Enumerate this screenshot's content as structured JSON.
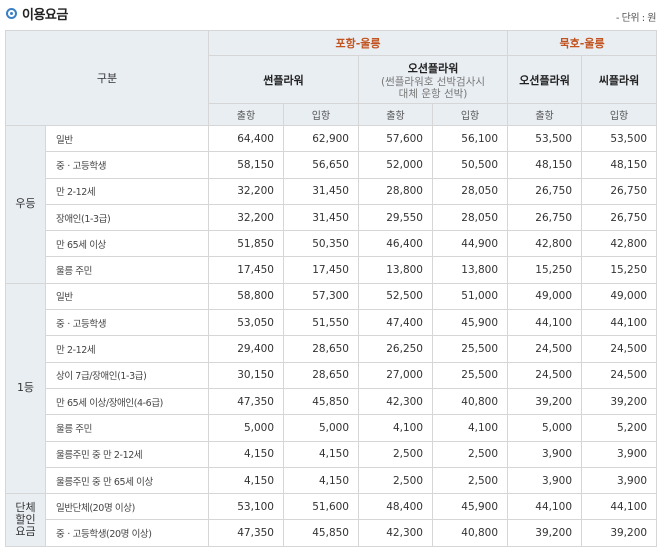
{
  "header": {
    "title": "이용요금",
    "unit": "- 단위 : 원"
  },
  "table": {
    "gubun": "구분",
    "groups": [
      {
        "label": "포항-울릉"
      },
      {
        "label": "묵호-울릉"
      }
    ],
    "ships": [
      {
        "name": "썬플라워",
        "sub": ""
      },
      {
        "name": "오션플라워",
        "sub": "(썬플라워호 선박검사시\n대체 운항 선박)"
      },
      {
        "name": "오션플라워",
        "sub": ""
      },
      {
        "name": "씨플라워",
        "sub": ""
      }
    ],
    "dirs": [
      "출항",
      "입항",
      "출항",
      "입항",
      "출항",
      "입항"
    ],
    "sections": [
      {
        "cls": "우등",
        "rows": [
          {
            "label": "일반",
            "values": [
              "64,400",
              "62,900",
              "57,600",
              "56,100",
              "53,500",
              "53,500"
            ]
          },
          {
            "label": "중ㆍ고등학생",
            "values": [
              "58,150",
              "56,650",
              "52,000",
              "50,500",
              "48,150",
              "48,150"
            ]
          },
          {
            "label": "만 2-12세",
            "values": [
              "32,200",
              "31,450",
              "28,800",
              "28,050",
              "26,750",
              "26,750"
            ]
          },
          {
            "label": "장애인(1-3급)",
            "values": [
              "32,200",
              "31,450",
              "29,550",
              "28,050",
              "26,750",
              "26,750"
            ]
          },
          {
            "label": "만 65세 이상",
            "values": [
              "51,850",
              "50,350",
              "46,400",
              "44,900",
              "42,800",
              "42,800"
            ]
          },
          {
            "label": "울릉 주민",
            "values": [
              "17,450",
              "17,450",
              "13,800",
              "13,800",
              "15,250",
              "15,250"
            ]
          }
        ]
      },
      {
        "cls": "1등",
        "rows": [
          {
            "label": "일반",
            "values": [
              "58,800",
              "57,300",
              "52,500",
              "51,000",
              "49,000",
              "49,000"
            ]
          },
          {
            "label": "중ㆍ고등학생",
            "values": [
              "53,050",
              "51,550",
              "47,400",
              "45,900",
              "44,100",
              "44,100"
            ]
          },
          {
            "label": "만 2-12세",
            "values": [
              "29,400",
              "28,650",
              "26,250",
              "25,500",
              "24,500",
              "24,500"
            ]
          },
          {
            "label": "상이 7급/장애인(1-3급)",
            "values": [
              "30,150",
              "28,650",
              "27,000",
              "25,500",
              "24,500",
              "24,500"
            ]
          },
          {
            "label": "만 65세 이상/장애인(4-6급)",
            "values": [
              "47,350",
              "45,850",
              "42,300",
              "40,800",
              "39,200",
              "39,200"
            ]
          },
          {
            "label": "울릉 주민",
            "values": [
              "5,000",
              "5,000",
              "4,100",
              "4,100",
              "5,000",
              "5,200"
            ]
          },
          {
            "label": "울릉주민 중 만 2-12세",
            "values": [
              "4,150",
              "4,150",
              "2,500",
              "2,500",
              "3,900",
              "3,900"
            ]
          },
          {
            "label": "울릉주민 중 만 65세 이상",
            "values": [
              "4,150",
              "4,150",
              "2,500",
              "2,500",
              "3,900",
              "3,900"
            ]
          }
        ]
      },
      {
        "cls": "단체\n할인\n요금",
        "rows": [
          {
            "label": "일반단체(20명 이상)",
            "values": [
              "53,100",
              "51,600",
              "48,400",
              "45,900",
              "44,100",
              "44,100"
            ]
          },
          {
            "label": "중ㆍ고등학생(20명 이상)",
            "values": [
              "47,350",
              "45,850",
              "42,300",
              "40,800",
              "39,200",
              "39,200"
            ]
          }
        ]
      }
    ]
  }
}
